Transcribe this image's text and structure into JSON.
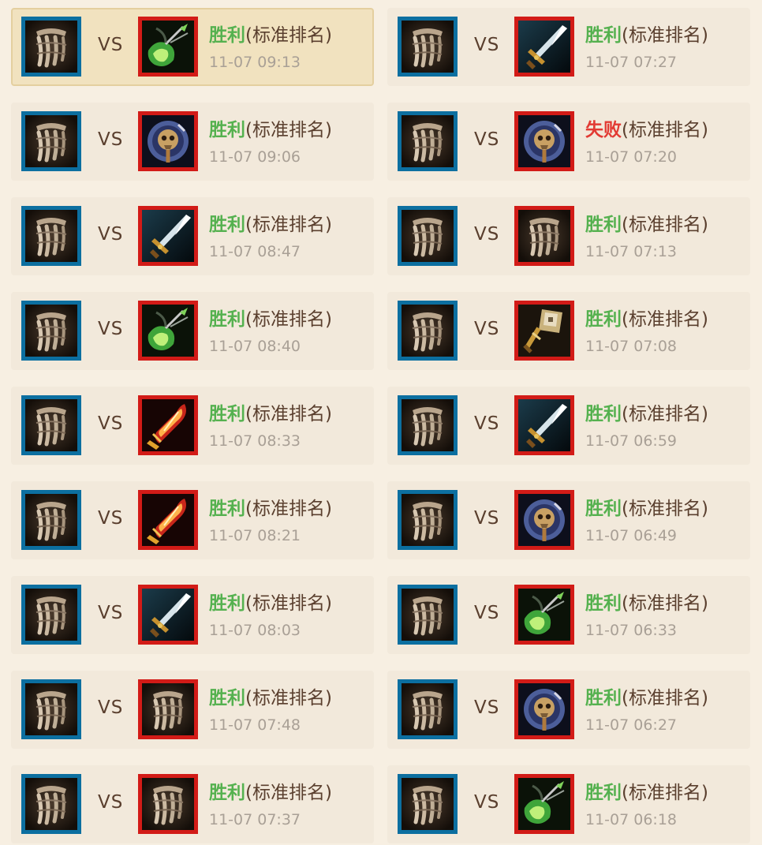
{
  "colors": {
    "win": "#55b14f",
    "lose": "#e23a33",
    "self_frame": "#0c6fa0",
    "opponent_frame": "#d21b17",
    "card_bg": "#f2e9db",
    "selected_bg": "#f1e2bf"
  },
  "matches": [
    {
      "self_icon": "bone-claw-icon",
      "opp_icon": "green-spirit-icon",
      "vs": "VS",
      "result": "胜利",
      "outcome": "win",
      "mode": "(标准排名)",
      "time": "11-07 09:13",
      "selected": true
    },
    {
      "self_icon": "bone-claw-icon",
      "opp_icon": "blue-sword-icon",
      "vs": "VS",
      "result": "胜利",
      "outcome": "win",
      "mode": "(标准排名)",
      "time": "11-07 07:27",
      "selected": false
    },
    {
      "self_icon": "bone-claw-icon",
      "opp_icon": "gold-skull-orb-icon",
      "vs": "VS",
      "result": "胜利",
      "outcome": "win",
      "mode": "(标准排名)",
      "time": "11-07 09:06",
      "selected": false
    },
    {
      "self_icon": "bone-claw-icon",
      "opp_icon": "gold-skull-orb-icon",
      "vs": "VS",
      "result": "失败",
      "outcome": "lose",
      "mode": "(标准排名)",
      "time": "11-07 07:20",
      "selected": false
    },
    {
      "self_icon": "bone-claw-icon",
      "opp_icon": "blue-sword-icon",
      "vs": "VS",
      "result": "胜利",
      "outcome": "win",
      "mode": "(标准排名)",
      "time": "11-07 08:47",
      "selected": false
    },
    {
      "self_icon": "bone-claw-icon",
      "opp_icon": "bone-claw-icon",
      "vs": "VS",
      "result": "胜利",
      "outcome": "win",
      "mode": "(标准排名)",
      "time": "11-07 07:13",
      "selected": false
    },
    {
      "self_icon": "bone-claw-icon",
      "opp_icon": "green-spirit-icon",
      "vs": "VS",
      "result": "胜利",
      "outcome": "win",
      "mode": "(标准排名)",
      "time": "11-07 08:40",
      "selected": false
    },
    {
      "self_icon": "bone-claw-icon",
      "opp_icon": "golden-hammer-icon",
      "vs": "VS",
      "result": "胜利",
      "outcome": "win",
      "mode": "(标准排名)",
      "time": "11-07 07:08",
      "selected": false
    },
    {
      "self_icon": "bone-claw-icon",
      "opp_icon": "flame-blade-icon",
      "vs": "VS",
      "result": "胜利",
      "outcome": "win",
      "mode": "(标准排名)",
      "time": "11-07 08:33",
      "selected": false
    },
    {
      "self_icon": "bone-claw-icon",
      "opp_icon": "blue-sword-icon",
      "vs": "VS",
      "result": "胜利",
      "outcome": "win",
      "mode": "(标准排名)",
      "time": "11-07 06:59",
      "selected": false
    },
    {
      "self_icon": "bone-claw-icon",
      "opp_icon": "flame-blade-icon",
      "vs": "VS",
      "result": "胜利",
      "outcome": "win",
      "mode": "(标准排名)",
      "time": "11-07 08:21",
      "selected": false
    },
    {
      "self_icon": "bone-claw-icon",
      "opp_icon": "gold-skull-orb-icon",
      "vs": "VS",
      "result": "胜利",
      "outcome": "win",
      "mode": "(标准排名)",
      "time": "11-07 06:49",
      "selected": false
    },
    {
      "self_icon": "bone-claw-icon",
      "opp_icon": "blue-sword-icon",
      "vs": "VS",
      "result": "胜利",
      "outcome": "win",
      "mode": "(标准排名)",
      "time": "11-07 08:03",
      "selected": false
    },
    {
      "self_icon": "bone-claw-icon",
      "opp_icon": "green-spirit-icon",
      "vs": "VS",
      "result": "胜利",
      "outcome": "win",
      "mode": "(标准排名)",
      "time": "11-07 06:33",
      "selected": false
    },
    {
      "self_icon": "bone-claw-icon",
      "opp_icon": "bone-claw-icon",
      "vs": "VS",
      "result": "胜利",
      "outcome": "win",
      "mode": "(标准排名)",
      "time": "11-07 07:48",
      "selected": false
    },
    {
      "self_icon": "bone-claw-icon",
      "opp_icon": "gold-skull-orb-icon",
      "vs": "VS",
      "result": "胜利",
      "outcome": "win",
      "mode": "(标准排名)",
      "time": "11-07 06:27",
      "selected": false
    },
    {
      "self_icon": "bone-claw-icon",
      "opp_icon": "bone-claw-icon",
      "vs": "VS",
      "result": "胜利",
      "outcome": "win",
      "mode": "(标准排名)",
      "time": "11-07 07:37",
      "selected": false
    },
    {
      "self_icon": "bone-claw-icon",
      "opp_icon": "green-spirit-icon",
      "vs": "VS",
      "result": "胜利",
      "outcome": "win",
      "mode": "(标准排名)",
      "time": "11-07 06:18",
      "selected": false
    }
  ]
}
